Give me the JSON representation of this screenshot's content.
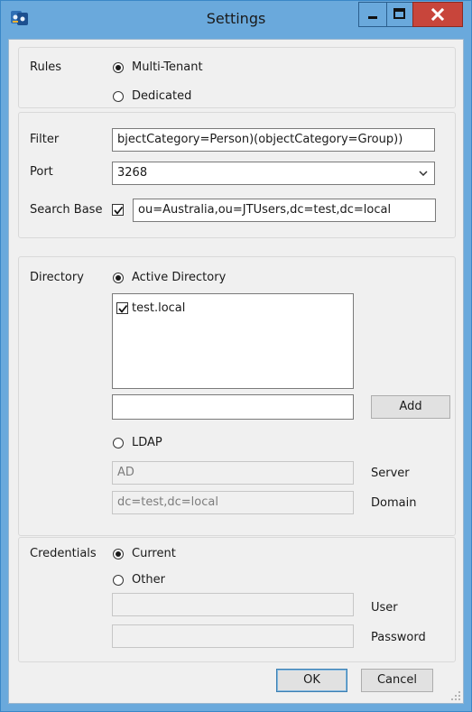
{
  "window": {
    "title": "Settings",
    "controls": {
      "minimize": "minimize",
      "maximize": "maximize",
      "close": "close"
    }
  },
  "rules": {
    "label": "Rules",
    "options": [
      {
        "label": "Multi-Tenant",
        "checked": true
      },
      {
        "label": "Dedicated",
        "checked": false
      }
    ]
  },
  "filter": {
    "label": "Filter",
    "value": "bjectCategory=Person)(objectCategory=Group))"
  },
  "port": {
    "label": "Port",
    "value": "3268"
  },
  "search_base": {
    "label": "Search Base",
    "checked": true,
    "value": "ou=Australia,ou=JTUsers,dc=test,dc=local"
  },
  "directory": {
    "label": "Directory",
    "active_directory_label": "Active Directory",
    "active_directory_checked": true,
    "domains": [
      {
        "label": "test.local",
        "checked": true
      }
    ],
    "new_domain_value": "",
    "add_label": "Add",
    "ldap_label": "LDAP",
    "ldap_checked": false,
    "server_value": "AD",
    "server_label": "Server",
    "domain_value": "dc=test,dc=local",
    "domain_label": "Domain"
  },
  "credentials": {
    "label": "Credentials",
    "current_label": "Current",
    "current_checked": true,
    "other_label": "Other",
    "other_checked": false,
    "user_value": "",
    "user_label": "User",
    "password_value": "",
    "password_label": "Password"
  },
  "footer": {
    "ok_label": "OK",
    "cancel_label": "Cancel"
  },
  "colors": {
    "titlebar": "#6aa9dc",
    "close_button": "#c8453b",
    "client_background": "#f0f0f0"
  }
}
